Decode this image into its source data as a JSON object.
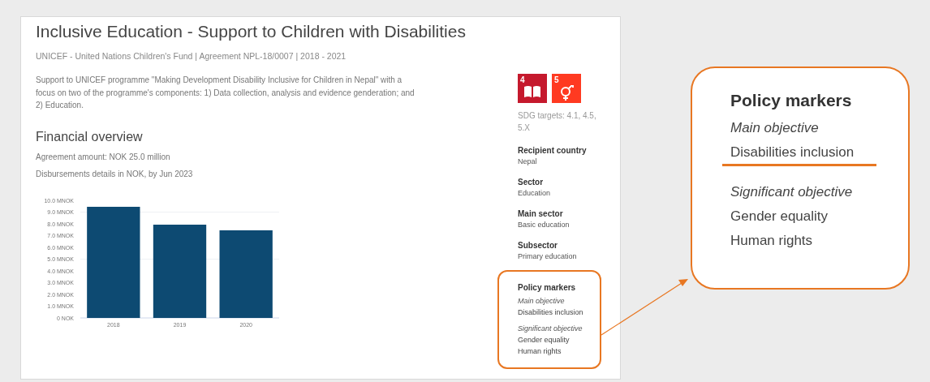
{
  "project": {
    "title": "Inclusive Education - Support to Children with Disabilities",
    "subtitle": "UNICEF - United Nations Children's Fund | Agreement NPL-18/0007 | 2018 - 2021",
    "description": "Support to UNICEF programme \"Making Development Disability Inclusive for Children in Nepal\" with a focus on two of the programme's components: 1) Data collection, analysis and evidence genderation; and 2) Education."
  },
  "financial": {
    "heading": "Financial overview",
    "lines": [
      "Agreement amount: NOK 25.0 million",
      "Disbursements details in NOK, by Jun 2023"
    ],
    "chart_data": {
      "type": "bar",
      "categories": [
        "2018",
        "2019",
        "2020"
      ],
      "series": [
        {
          "color": "#0d4a72",
          "values": [
            9.45,
            7.93,
            7.45
          ]
        }
      ],
      "ylim": [
        0,
        10
      ],
      "yticks": [
        {
          "value": 0,
          "label": "0 NOK"
        },
        {
          "value": 1,
          "label": "1.0 MNOK"
        },
        {
          "value": 2,
          "label": "2.0 MNOK"
        },
        {
          "value": 3,
          "label": "3.0 MNOK"
        },
        {
          "value": 4,
          "label": "4.0 MNOK"
        },
        {
          "value": 5,
          "label": "5.0 MNOK"
        },
        {
          "value": 6,
          "label": "6.0 MNOK"
        },
        {
          "value": 7,
          "label": "7.0 MNOK"
        },
        {
          "value": 8,
          "label": "8.0 MNOK"
        },
        {
          "value": 9,
          "label": "9.0 MNOK"
        },
        {
          "value": 10,
          "label": "10.0 MNOK"
        }
      ]
    }
  },
  "sidebar": {
    "sdg_tiles": [
      {
        "number": "4",
        "kind": "book",
        "color": "#c5192d"
      },
      {
        "number": "5",
        "kind": "gender",
        "color": "#ff3a21"
      }
    ],
    "sdg_targets": "SDG targets: 4.1, 4.5, 5.X",
    "fields": [
      {
        "label": "Recipient country",
        "value": "Nepal"
      },
      {
        "label": "Sector",
        "value": "Education"
      },
      {
        "label": "Main sector",
        "value": "Basic education"
      },
      {
        "label": "Subsector",
        "value": "Primary education"
      }
    ],
    "policy_markers": {
      "heading": "Policy markers",
      "groups": [
        {
          "objective": "Main objective",
          "items": [
            "Disabilities inclusion"
          ]
        },
        {
          "objective": "Significant objective",
          "items": [
            "Gender equality",
            "Human rights"
          ]
        }
      ]
    }
  },
  "callout": {
    "heading": "Policy markers",
    "groups": [
      {
        "objective": "Main objective",
        "items": [
          {
            "text": "Disabilities inclusion",
            "highlighted": true
          }
        ]
      },
      {
        "objective": "Significant objective",
        "items": [
          {
            "text": "Gender equality",
            "highlighted": false
          },
          {
            "text": "Human rights",
            "highlighted": false
          }
        ]
      }
    ]
  }
}
